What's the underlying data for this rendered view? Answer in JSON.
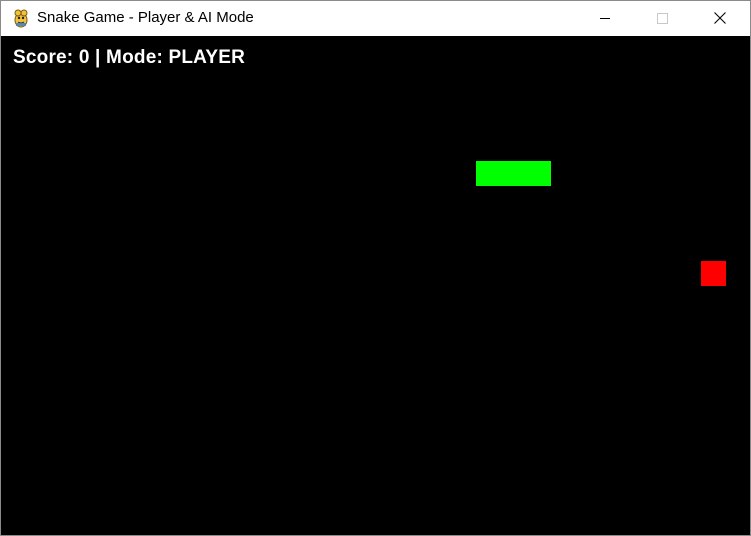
{
  "window": {
    "title": "Snake Game - Player & AI Mode",
    "icon": "pygame-snake-icon",
    "controls": [
      "minimize",
      "maximize",
      "close"
    ]
  },
  "hud": {
    "text": "Score: 0 | Mode: PLAYER",
    "score": 0,
    "mode": "PLAYER"
  },
  "game": {
    "background_color": "#000000",
    "snake_color": "#00ff00",
    "food_color": "#ff0000",
    "snake_length": 3
  }
}
